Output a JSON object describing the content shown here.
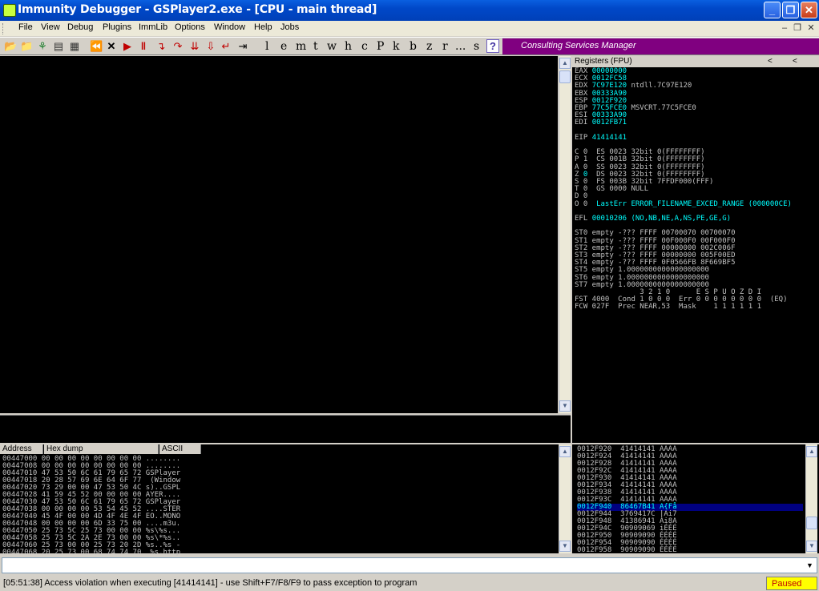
{
  "window": {
    "title": "Immunity Debugger - GSPlayer2.exe - [CPU - main thread]",
    "minimize": "_",
    "maximize": "❐",
    "close": "✕"
  },
  "menu": {
    "items": [
      "File",
      "View",
      "Debug",
      "Plugins",
      "ImmLib",
      "Options",
      "Window",
      "Help",
      "Jobs"
    ],
    "mdi": [
      "–",
      "❐",
      "✕"
    ]
  },
  "toolbar": {
    "letters": [
      "l",
      "e",
      "m",
      "t",
      "w",
      "h",
      "c",
      "P",
      "k",
      "b",
      "z",
      "r",
      "...",
      "s"
    ],
    "help": "?",
    "banner": "Consulting Services Manager"
  },
  "registers": {
    "header": "Registers (FPU)",
    "nav": [
      "<",
      "<"
    ],
    "lines": [
      [
        "EAX ",
        "00000000",
        ""
      ],
      [
        "ECX ",
        "0012FC58",
        ""
      ],
      [
        "EDX ",
        "7C97E120",
        " ntdll.7C97E120"
      ],
      [
        "EBX ",
        "00333A90",
        ""
      ],
      [
        "ESP ",
        "0012F920",
        ""
      ],
      [
        "EBP ",
        "77C5FCE0",
        " MSVCRT.77C5FCE0"
      ],
      [
        "ESI ",
        "00333A90",
        ""
      ],
      [
        "EDI ",
        "0012FB71",
        ""
      ],
      [
        "",
        "",
        " "
      ],
      [
        "EIP ",
        "41414141",
        ""
      ],
      [
        "",
        "",
        " "
      ],
      [
        "C 0  ",
        "",
        "ES 0023 32bit 0(FFFFFFFF)"
      ],
      [
        "P 1  ",
        "",
        "CS 001B 32bit 0(FFFFFFFF)"
      ],
      [
        "A 0  ",
        "",
        "SS 0023 32bit 0(FFFFFFFF)"
      ],
      [
        "Z ",
        "0",
        "  DS 0023 32bit 0(FFFFFFFF)"
      ],
      [
        "S 0  ",
        "",
        "FS 003B 32bit 7FFDF000(FFF)"
      ],
      [
        "T 0  ",
        "",
        "GS 0000 NULL"
      ],
      [
        "D 0",
        "",
        " "
      ],
      [
        "O 0  ",
        "",
        "LastErr ERROR_FILENAME_EXCED_RANGE (000000CE)"
      ],
      [
        "",
        "",
        " "
      ],
      [
        "EFL ",
        "00010206",
        " (NO,NB,NE,A,NS,PE,GE,G)"
      ],
      [
        "",
        "",
        " "
      ],
      [
        "ST0 empty -??? FFFF 00700070 00700070",
        "",
        ""
      ],
      [
        "ST1 empty -??? FFFF 00F000F0 00F000F0",
        "",
        ""
      ],
      [
        "ST2 empty -??? FFFF 00000000 002C006F",
        "",
        ""
      ],
      [
        "ST3 empty -??? FFFF 00000000 005F00ED",
        "",
        ""
      ],
      [
        "ST4 empty -??? FFFF 0F0566FB 8F669BF5",
        "",
        ""
      ],
      [
        "ST5 empty 1.0000000000000000000",
        "",
        ""
      ],
      [
        "ST6 empty 1.0000000000000000000",
        "",
        ""
      ],
      [
        "ST7 empty 1.0000000000000000000",
        "",
        ""
      ],
      [
        "               3 2 1 0      E S P U O Z D I",
        "",
        ""
      ],
      [
        "FST 4000  Cond 1 0 0 0  Err 0 0 0 0 0 0 0 0  (EQ)",
        "",
        ""
      ],
      [
        "FCW 027F  Prec NEAR,53  Mask    1 1 1 1 1 1",
        "",
        ""
      ]
    ]
  },
  "hexdump": {
    "headers": [
      "Address",
      "Hex dump",
      "ASCII"
    ],
    "rows": [
      "00447000 00 00 00 00 00 00 00 00 ........",
      "00447008 00 00 00 00 00 00 00 00 ........",
      "00447010 47 53 50 6C 61 79 65 72 GSPlayer",
      "00447018 20 28 57 69 6E 64 6F 77  (Window",
      "00447020 73 29 00 00 47 53 50 4C s)..GSPL",
      "00447028 41 59 45 52 00 00 00 00 AYER....",
      "00447030 47 53 50 6C 61 79 65 72 GSPlayer",
      "00447038 00 00 00 00 53 54 45 52 ....STER",
      "00447040 45 4F 00 00 4D 4F 4E 4F EO..MONO",
      "00447048 00 00 00 00 6D 33 75 00 ....m3u.",
      "00447050 25 73 5C 25 73 00 00 00 %s\\%s...",
      "00447058 25 73 5C 2A 2E 73 00 00 %s\\*%s..",
      "00447060 25 73 00 00 25 73 20 2D %s..%s -",
      "00447068 20 25 73 00 68 74 74 70  %s.http"
    ]
  },
  "stack": {
    "rows": [
      "0012F920  41414141 AAAA",
      "0012F924  41414141 AAAA",
      "0012F928  41414141 AAAA",
      "0012F92C  41414141 AAAA",
      "0012F930  41414141 AAAA",
      "0012F934  41414141 AAAA",
      "0012F938  41414141 AAAA",
      "0012F93C  41414141 AAAA",
      "0012F940  86467B41 A{Få",
      "0012F944  3769417C |Ai7",
      "0012F948  41386941 Ai8A",
      "0012F94C  90909069 iÉÉÉ",
      "0012F950  90909090 ÉÉÉÉ",
      "0012F954  90909090 ÉÉÉÉ",
      "0012F958  90909090 ÉÉÉÉ"
    ],
    "selected_index": 8
  },
  "command": {
    "value": "",
    "dropdown": "▼"
  },
  "status": {
    "message": "[05:51:38] Access violation when executing [41414141] - use Shift+F7/F8/F9 to pass exception to program",
    "state": "Paused"
  }
}
